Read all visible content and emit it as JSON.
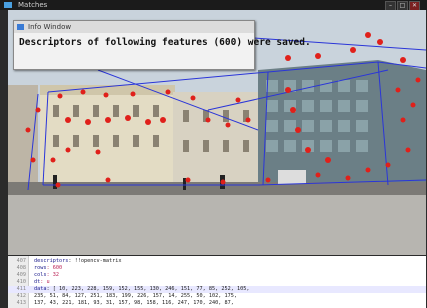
{
  "window": {
    "title": "Matches"
  },
  "info_window": {
    "title": "Info Window",
    "message": "Descriptors of following features (600) were saved."
  },
  "editor": {
    "lines": [
      {
        "number": "407",
        "key": "descriptors",
        "rest": ": !!opencv-matrix"
      },
      {
        "number": "408",
        "key": "   rows",
        "rest": ": 600"
      },
      {
        "number": "409",
        "key": "   cols",
        "rest": ": 32"
      },
      {
        "number": "410",
        "key": "   dt",
        "rest": ": u"
      },
      {
        "number": "411",
        "key": "   data",
        "rest": ": [ 10, 223, 228, 159, 152, 155, 130, 246, 151, 77, 85, 252, 105,"
      },
      {
        "number": "412",
        "key": "",
        "rest": "      235, 51, 84, 127, 251, 183, 199, 226, 157, 14, 255, 50, 102, 175,"
      },
      {
        "number": "413",
        "key": "",
        "rest": "      137, 43, 221, 181, 93, 31, 157, 98, 158, 116, 247, 170, 240, 87,"
      }
    ]
  }
}
